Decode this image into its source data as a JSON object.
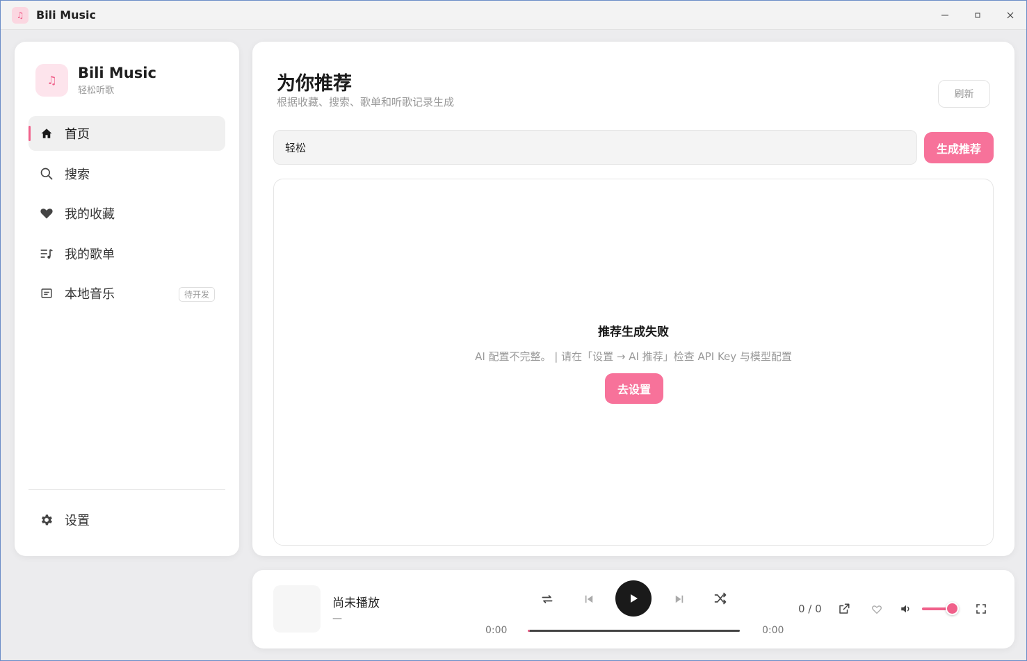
{
  "window": {
    "title": "Bili Music",
    "controls": {
      "minimize": "—",
      "maximize": "◻",
      "close": "✕"
    }
  },
  "brand": {
    "name": "Bili Music",
    "subtitle": "轻松听歌",
    "icon": "music-note-icon"
  },
  "sidebar": {
    "items": [
      {
        "label": "首页",
        "icon": "home-icon",
        "active": true
      },
      {
        "label": "搜索",
        "icon": "search-icon"
      },
      {
        "label": "我的收藏",
        "icon": "heart-icon"
      },
      {
        "label": "我的歌单",
        "icon": "playlist-icon"
      },
      {
        "label": "本地音乐",
        "icon": "local-music-icon",
        "badge": "待开发"
      }
    ],
    "settings": {
      "label": "设置",
      "icon": "gear-icon"
    }
  },
  "main": {
    "title": "为你推荐",
    "subtitle": "根据收藏、搜索、歌单和听歌记录生成",
    "refresh_label": "刷新",
    "prompt_value": "轻松",
    "generate_label": "生成推荐",
    "error": {
      "title": "推荐生成失败",
      "message": "AI 配置不完整。 | 请在「设置 → AI 推荐」检查 API Key 与模型配置",
      "action_label": "去设置"
    }
  },
  "player": {
    "track_title": "尚未播放",
    "track_artist": "—",
    "time_current": "0:00",
    "time_total": "0:00",
    "progress": 0.01,
    "queue": "0 / 0",
    "volume": 1.0
  },
  "colors": {
    "accent": "#f7729a",
    "accent_dark": "#f0608a"
  }
}
